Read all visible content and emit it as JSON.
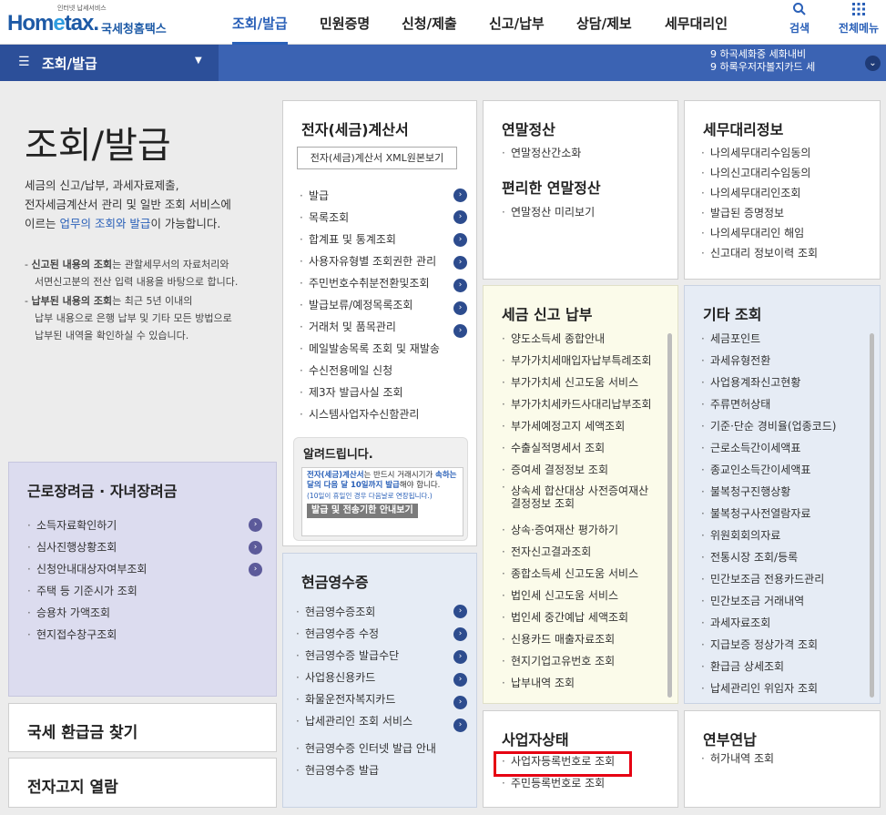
{
  "header": {
    "logo_tagline": "인터넷 납세서비스",
    "logo_brand_a": "Hom",
    "logo_brand_e": "e",
    "logo_brand_b": "tax.",
    "logo_kr": "국세청홈택스",
    "nav": [
      "조회/발급",
      "민원증명",
      "신청/제출",
      "신고/납부",
      "상담/제보",
      "세무대리인"
    ],
    "search_label": "검색",
    "allmenu_label": "전체메뉴"
  },
  "bar": {
    "menu_title": "조회/발급",
    "ticker": [
      "9  하곡세화중 세화내비",
      "9  하록우저자볼지카드 세"
    ]
  },
  "intro": {
    "title": "조회/발급",
    "desc1": "세금의 신고/납부, 과세자료제출,",
    "desc2": "전자세금계산서 관리 및 일반 조회 서비스에",
    "desc3a": "이르는 ",
    "desc3b": "업무의 조회와 발급",
    "desc3c": "이 가능합니다.",
    "n1a": "신고된 내용의 조회",
    "n1b": "는 관할세무서의 자료처리와",
    "n1c": "서면신고분의 전산 입력 내용을 바탕으로 합니다.",
    "n2a": "납부된 내용의 조회",
    "n2b": "는 최근 5년 이내의",
    "n2c": "납부 내용으로 은행 납부 및 기타 모든 방법으로",
    "n2d": "납부된 내역을 확인하실 수 있습니다."
  },
  "card_earned": {
    "title": "근로장려금 · 자녀장려금",
    "items": [
      "소득자료확인하기",
      "심사진행상황조회",
      "신청안내대상자여부조회",
      "주택 등 기준시가 조회",
      "승용차 가액조회",
      "현지접수창구조회"
    ]
  },
  "refund": {
    "title": "국세 환급금 찾기"
  },
  "enotice": {
    "title": "전자고지 열람"
  },
  "card_einvoice": {
    "title": "전자(세금)계산서",
    "xml_button": "전자(세금)계산서 XML원본보기",
    "items": [
      "발급",
      "목록조회",
      "합계표 및 통계조회",
      "사용자유형별 조회권한 관리",
      "주민번호수취분전환및조회",
      "발급보류/예정목록조회",
      "거래처 및 품목관리",
      "메일발송목록 조회 및 재발송",
      "수신전용메일 신청",
      "제3자 발급사실 조회",
      "시스템사업자수신함관리"
    ],
    "notice_title": "알려드립니다.",
    "notice_a": "전자(세금)계산서",
    "notice_b": "는 반드시 거래시기가",
    "notice_c": "속하는 달의 다음 달 10일까지 발급",
    "notice_d": "해야",
    "notice_e": "합니다.",
    "notice_f": "(10일이 휴일인 경우 다음날로 연장됩니다.)",
    "notice_button": "발급 및 전송기한 안내보기"
  },
  "card_cash": {
    "title": "현금영수증",
    "items": [
      "현금영수증조회",
      "현금영수증 수정",
      "현금영수증 발급수단",
      "사업용신용카드",
      "화물운전자복지카드",
      "납세관리인 조회 서비스",
      "현금영수증 인터넷 발급 안내",
      "현금영수증 발급"
    ]
  },
  "card_yearend": {
    "title": "연말정산",
    "items": [
      "연말정산간소화"
    ],
    "title2": "편리한 연말정산",
    "items2": [
      "연말정산 미리보기"
    ]
  },
  "card_tax": {
    "title": "세금 신고 납부",
    "items": [
      "양도소득세 종합안내",
      "부가가치세매입자납부특례조회",
      "부가가치세 신고도움 서비스",
      "부가가치세카드사대리납부조회",
      "부가세예정고지 세액조회",
      "수출실적명세서 조회",
      "증여세 결정정보 조회",
      "상속세 합산대상 사전증여재산 결정정보 조회",
      "상속·증여재산 평가하기",
      "전자신고결과조회",
      "종합소득세 신고도움 서비스",
      "법인세 신고도움 서비스",
      "법인세 중간예납 세액조회",
      "신용카드 매출자료조회",
      "현지기업고유번호 조회",
      "납부내역 조회"
    ]
  },
  "card_biz": {
    "title": "사업자상태",
    "items": [
      "사업자등록번호로 조회",
      "주민등록번호로 조회"
    ]
  },
  "card_agent": {
    "title": "세무대리정보",
    "items": [
      "나의세무대리수임동의",
      "나의신고대리수임동의",
      "나의세무대리인조회",
      "발급된 증명정보",
      "나의세무대리인 해임",
      "신고대리 정보이력 조회"
    ]
  },
  "card_etc": {
    "title": "기타 조회",
    "items": [
      "세금포인트",
      "과세유형전환",
      "사업용계좌신고현황",
      "주류면허상태",
      "기준·단순 경비율(업종코드)",
      "근로소득간이세액표",
      "종교인소득간이세액표",
      "불복청구진행상황",
      "불복청구사전열람자료",
      "위원회회의자료",
      "전통시장 조회/등록",
      "민간보조금 전용카드관리",
      "민간보조금 거래내역",
      "과세자료조회",
      "지급보증 정상가격 조회",
      "환급금 상세조회",
      "납세관리인 위임자 조회"
    ]
  },
  "card_annual": {
    "title": "연부연납",
    "items": [
      "허가내역 조회"
    ]
  },
  "colors": {
    "primary": "#2a60b8",
    "bar": "#3b63b3",
    "lavender": "#dcdcef",
    "cream": "#fbfbea",
    "lightblue": "#e6ecf5",
    "highlight": "#e60012"
  }
}
